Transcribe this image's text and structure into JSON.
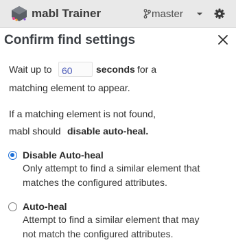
{
  "header": {
    "app_title": "mabl Trainer",
    "branch": "master"
  },
  "dialog": {
    "title": "Confirm find settings",
    "wait_prefix": "Wait up to",
    "wait_value": "60",
    "wait_unit": "seconds",
    "wait_suffix": "for a",
    "wait_line2": "matching element to appear.",
    "fallback_line1": "If a matching element is not found,",
    "fallback_prefix": "mabl should",
    "fallback_action": "disable auto-heal.",
    "options": [
      {
        "label": "Disable Auto-heal",
        "line1": "Only attempt to find a similar element that",
        "line2": "matches the configured attributes.",
        "selected": true
      },
      {
        "label": "Auto-heal",
        "line1": "Attempt to find a similar element that may",
        "line2": "not match the configured attributes.",
        "selected": false
      }
    ]
  },
  "colors": {
    "accent": "#1b6fd8",
    "input_text": "#4b5ab8",
    "topbar_bg": "#e9e9e9"
  },
  "icons": [
    "mabl-logo-icon",
    "branch-icon",
    "chevron-down-icon",
    "gear-icon",
    "close-icon"
  ]
}
